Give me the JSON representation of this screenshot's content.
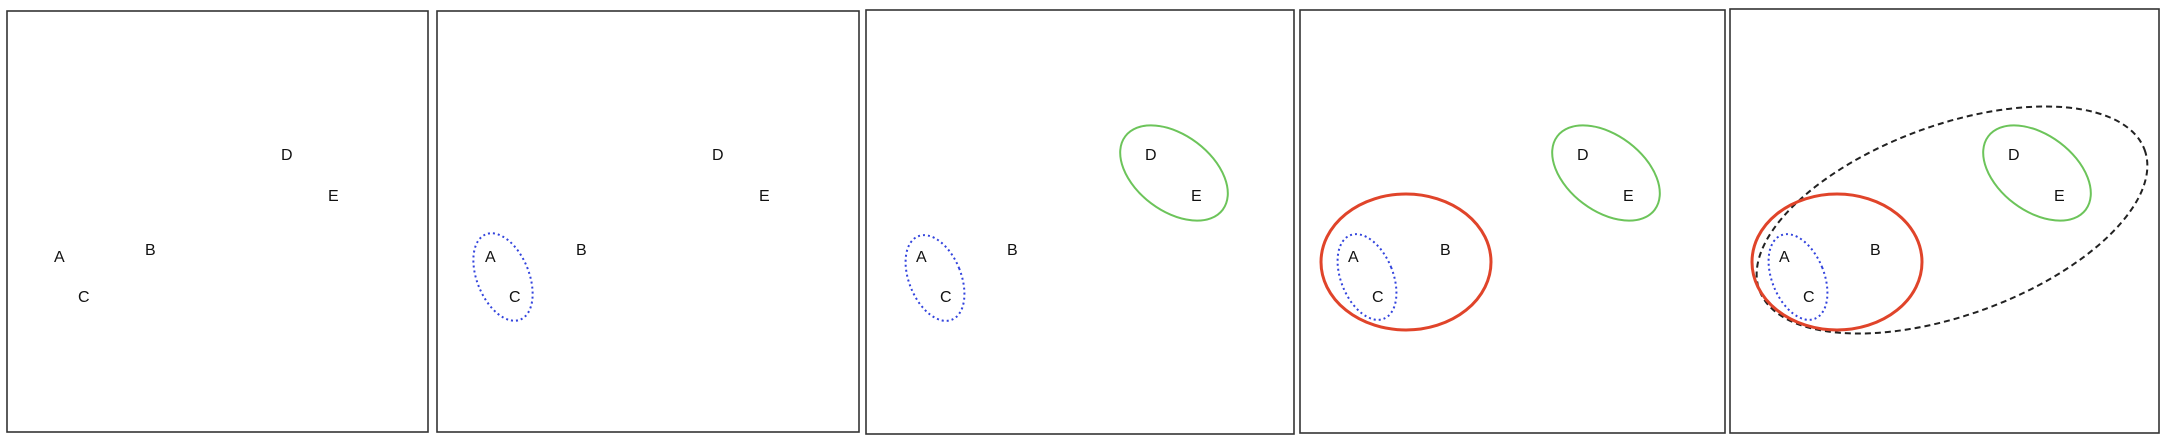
{
  "panels": [
    {
      "points": [
        {
          "label": "A"
        },
        {
          "label": "B"
        },
        {
          "label": "C"
        },
        {
          "label": "D"
        },
        {
          "label": "E"
        }
      ],
      "clusters": []
    },
    {
      "points": [
        {
          "label": "A"
        },
        {
          "label": "B"
        },
        {
          "label": "C"
        },
        {
          "label": "D"
        },
        {
          "label": "E"
        }
      ],
      "clusters": [
        {
          "members": [
            "A",
            "C"
          ],
          "style": "dotted",
          "color": "#3344dd"
        }
      ]
    },
    {
      "points": [
        {
          "label": "A"
        },
        {
          "label": "B"
        },
        {
          "label": "C"
        },
        {
          "label": "D"
        },
        {
          "label": "E"
        }
      ],
      "clusters": [
        {
          "members": [
            "A",
            "C"
          ],
          "style": "dotted",
          "color": "#3344dd"
        },
        {
          "members": [
            "D",
            "E"
          ],
          "style": "solid",
          "color": "#6cc45a"
        }
      ]
    },
    {
      "points": [
        {
          "label": "A"
        },
        {
          "label": "B"
        },
        {
          "label": "C"
        },
        {
          "label": "D"
        },
        {
          "label": "E"
        }
      ],
      "clusters": [
        {
          "members": [
            "A",
            "C"
          ],
          "style": "dotted",
          "color": "#3344dd"
        },
        {
          "members": [
            "D",
            "E"
          ],
          "style": "solid",
          "color": "#6cc45a"
        },
        {
          "members": [
            "A",
            "B",
            "C"
          ],
          "style": "solid-thick",
          "color": "#e0442a"
        }
      ]
    },
    {
      "points": [
        {
          "label": "A"
        },
        {
          "label": "B"
        },
        {
          "label": "C"
        },
        {
          "label": "D"
        },
        {
          "label": "E"
        }
      ],
      "clusters": [
        {
          "members": [
            "A",
            "C"
          ],
          "style": "dotted",
          "color": "#3344dd"
        },
        {
          "members": [
            "D",
            "E"
          ],
          "style": "solid",
          "color": "#6cc45a"
        },
        {
          "members": [
            "A",
            "B",
            "C"
          ],
          "style": "solid-thick",
          "color": "#e0442a"
        },
        {
          "members": [
            "A",
            "B",
            "C",
            "D",
            "E"
          ],
          "style": "dashed",
          "color": "#222222"
        }
      ]
    }
  ]
}
